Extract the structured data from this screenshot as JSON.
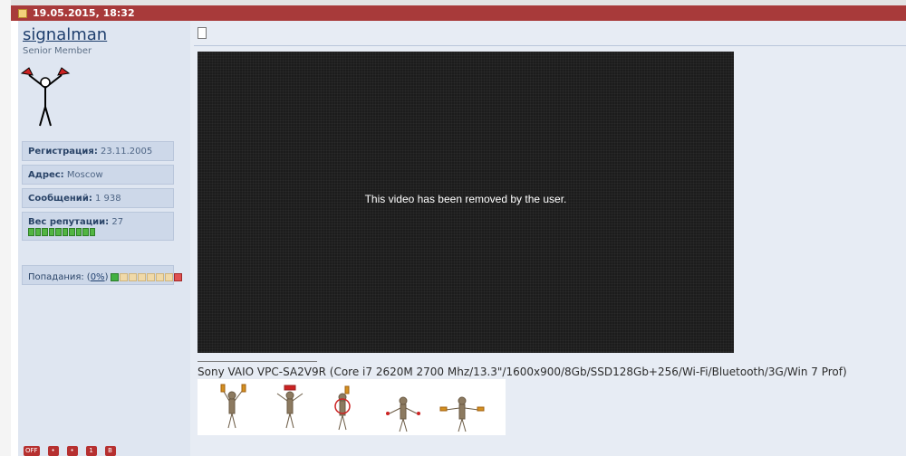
{
  "post": {
    "datetime": "19.05.2015, 18:32"
  },
  "user": {
    "name": "signalman",
    "title": "Senior Member",
    "fields": [
      {
        "label": "Регистрация:",
        "value": "23.11.2005"
      },
      {
        "label": "Адрес:",
        "value": "Moscow"
      },
      {
        "label": "Сообщений:",
        "value": "1 938"
      },
      {
        "label": "Вес репутации:",
        "value": "27"
      }
    ],
    "reputation_pips": 10,
    "hits": {
      "label": "Попадания:",
      "open": "(",
      "value": "0%",
      "close": ")"
    }
  },
  "content": {
    "video_message": "This video has been removed by the user.",
    "signature": "Sony VAIO VPC-SA2V9R (Core i7 2620M 2700 Mhz/13.3\"/1600x900/8Gb/SSD128Gb+256/Wi-Fi/Bluetooth/3G/Win 7 Prof)"
  },
  "bottom_buttons": [
    "OFF",
    "•",
    "•",
    "1",
    "B"
  ]
}
